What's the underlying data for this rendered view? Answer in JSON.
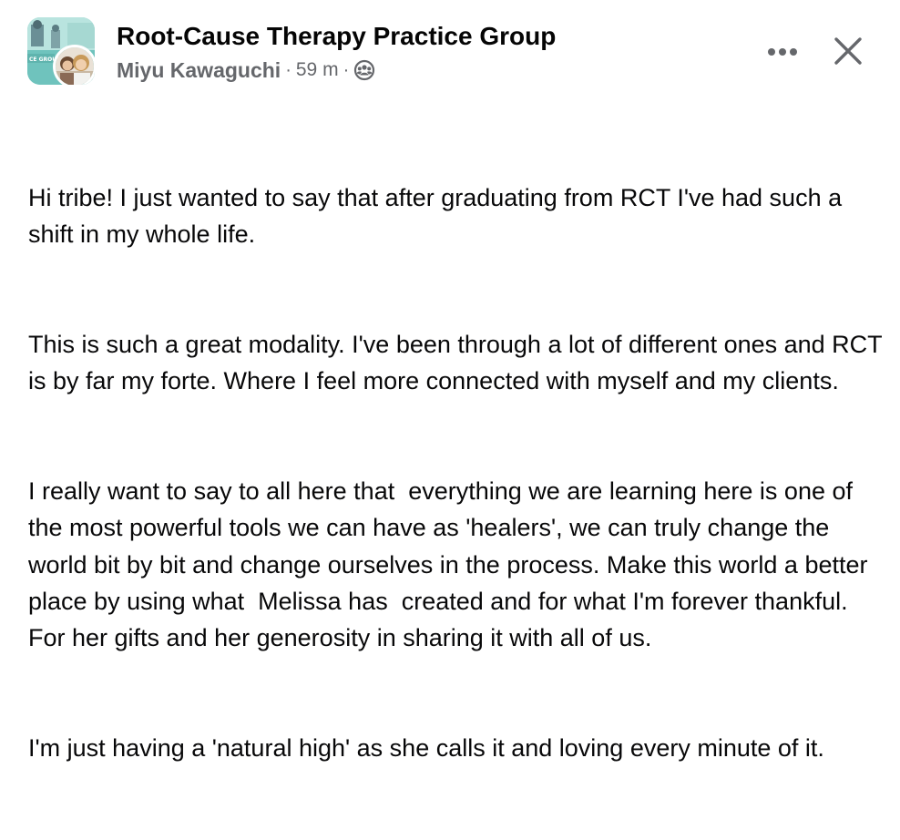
{
  "post": {
    "group_name": "Root-Cause Therapy Practice Group",
    "author": "Miyu Kawaguchi",
    "separator": "·",
    "time": "59 m",
    "privacy_icon": "group-members-icon",
    "more_icon": "more-options-icon",
    "close_icon": "close-icon",
    "group_avatar_caption": "CE GROUP",
    "paragraphs": [
      "Hi tribe! I just wanted to say that after graduating from RCT I've had such a shift in my whole life.",
      "This is such a great modality. I've been through a lot of different ones and RCT is by far my forte. Where I feel more connected with myself and my clients.",
      "I really want to say to all here that  everything we are learning here is one of the most powerful tools we can have as 'healers', we can truly change the world bit by bit and change ourselves in the process. Make this world a better place by using what  Melissa has  created and for what I'm forever thankful. For her gifts and her generosity in sharing it with all of us.",
      "I'm just having a 'natural high' as she calls it and loving every minute of it."
    ]
  },
  "colors": {
    "primary_text": "#050505",
    "secondary_text": "#65676b",
    "icon": "#65676b",
    "group_avatar_teal": "#6fc3bd"
  }
}
